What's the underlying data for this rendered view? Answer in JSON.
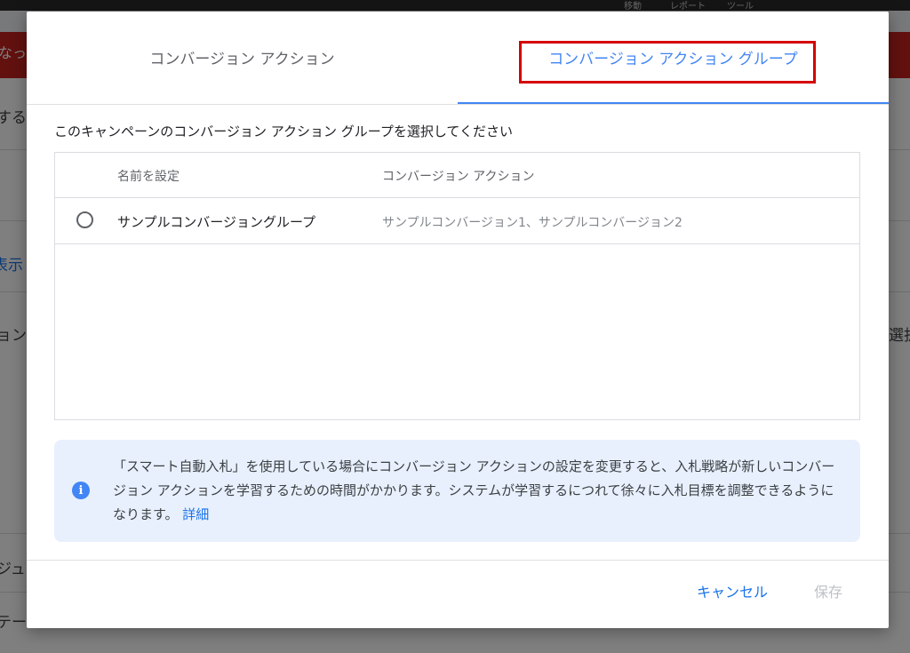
{
  "background": {
    "topbar_items": [
      "移動",
      "レポート",
      "ツール"
    ],
    "red_bar_text": "なっ",
    "side_fragments": {
      "left_1": "する",
      "left_2": "表示",
      "left_3": "ョン",
      "left_4": "ジュ",
      "left_5": "テー",
      "right_1": "選択"
    }
  },
  "dialog": {
    "tabs": [
      {
        "label": "コンバージョン アクション"
      },
      {
        "label": "コンバージョン アクション グループ"
      }
    ],
    "instruction": "このキャンペーンのコンバージョン アクション グループを選択してください",
    "table": {
      "headers": [
        "名前を設定",
        "コンバージョン アクション"
      ],
      "rows": [
        {
          "name": "サンプルコンバージョングループ",
          "actions": "サンプルコンバージョン1、サンプルコンバージョン2",
          "selected": false
        }
      ]
    },
    "info": {
      "icon": "info-icon",
      "text": "「スマート自動入札」を使用している場合にコンバージョン アクションの設定を変更すると、入札戦略が新しいコンバージョン アクションを学習するための時間がかかります。システムが学習するにつれて徐々に入札目標を調整できるようになります。",
      "link": "詳細"
    },
    "buttons": {
      "cancel": "キャンセル",
      "save": "保存"
    },
    "colors": {
      "accent": "#4285f4",
      "link": "#1a73e8",
      "highlight_box": "#d50000",
      "info_bg": "#e8f0fe",
      "disabled": "#bdc1c6"
    }
  }
}
